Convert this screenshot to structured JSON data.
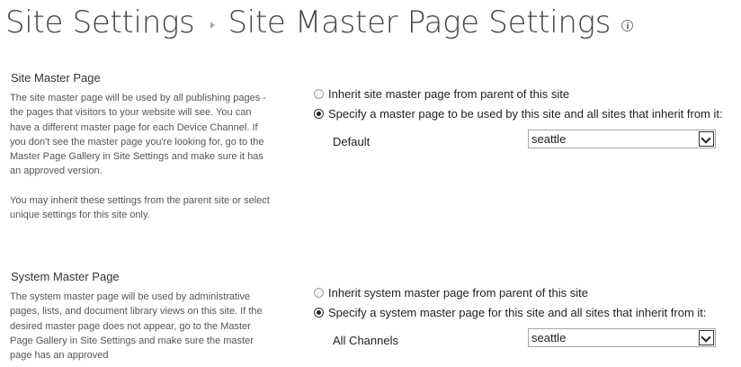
{
  "header": {
    "breadcrumb_root": "Site Settings",
    "page_title": "Site Master Page Settings"
  },
  "site_master": {
    "title": "Site Master Page",
    "description_1": "The site master page will be used by all publishing pages - the pages that visitors to your website will see. You can have a different master page for each Device Channel. If you don't see the master page you're looking for, go to the Master Page Gallery in Site Settings and make sure it has an approved version.",
    "description_2": "You may inherit these settings from the parent site or select unique settings for this site only.",
    "option_inherit": "Inherit site master page from parent of this site",
    "option_specify": "Specify a master page to be used by this site and all sites that inherit from it:",
    "selected_option": "specify",
    "channel_label": "Default",
    "selected_value": "seattle"
  },
  "system_master": {
    "title": "System Master Page",
    "description_1": "The system master page will be used by administrative pages, lists, and document library views on this site. If the desired master page does not appear, go to the Master Page Gallery in Site Settings and make sure the master page has an approved",
    "option_inherit": "Inherit system master page from parent of this site",
    "option_specify": "Specify a system master page for this site and all sites that inherit from it:",
    "selected_option": "specify",
    "channel_label": "All Channels",
    "selected_value": "seattle"
  }
}
